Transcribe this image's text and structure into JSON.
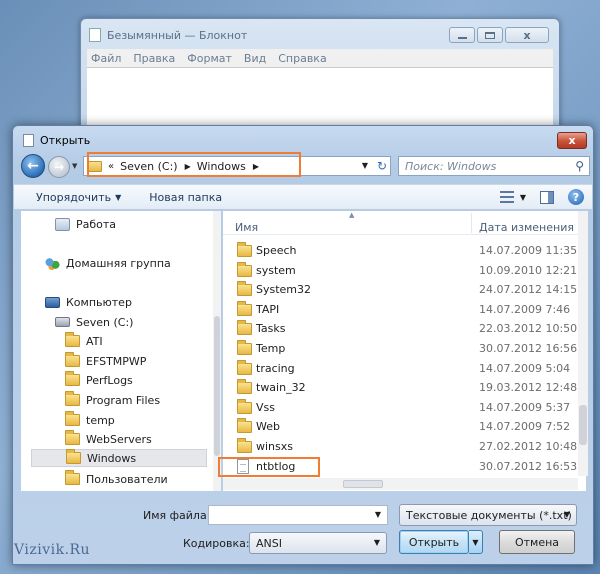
{
  "notepad": {
    "title": "Безымянный — Блокнот",
    "menu": [
      "Файл",
      "Правка",
      "Формат",
      "Вид",
      "Справка"
    ],
    "close_glyph": "x"
  },
  "dialog": {
    "title": "Открыть",
    "close_glyph": "x",
    "address": {
      "overflow": "«",
      "segments": [
        "Seven (C:)",
        "Windows"
      ]
    },
    "search_placeholder": "Поиск: Windows",
    "toolbar": {
      "organize": "Упорядочить",
      "new_folder": "Новая папка"
    },
    "nav": [
      {
        "label": "Работа",
        "icon": "work-icon"
      },
      {
        "label": "Домашняя группа",
        "icon": "homegroup-icon"
      },
      {
        "label": "Компьютер",
        "icon": "computer-icon"
      },
      {
        "label": "Seven (C:)",
        "icon": "drive-icon"
      },
      {
        "label": "ATI",
        "icon": "folder-icon"
      },
      {
        "label": "EFSTMPWP",
        "icon": "folder-icon"
      },
      {
        "label": "PerfLogs",
        "icon": "folder-icon"
      },
      {
        "label": "Program Files",
        "icon": "folder-icon"
      },
      {
        "label": "temp",
        "icon": "folder-icon"
      },
      {
        "label": "WebServers",
        "icon": "folder-icon"
      },
      {
        "label": "Windows",
        "icon": "folder-icon",
        "selected": true
      },
      {
        "label": "Пользователи",
        "icon": "folder-icon"
      }
    ],
    "columns": {
      "name": "Имя",
      "date": "Дата изменения"
    },
    "files": [
      {
        "name": "Speech",
        "date": "14.07.2009 11:35",
        "type": "folder"
      },
      {
        "name": "system",
        "date": "10.09.2010 12:21",
        "type": "folder"
      },
      {
        "name": "System32",
        "date": "24.07.2012 14:15",
        "type": "folder"
      },
      {
        "name": "TAPI",
        "date": "14.07.2009 7:46",
        "type": "folder"
      },
      {
        "name": "Tasks",
        "date": "22.03.2012 10:50",
        "type": "folder"
      },
      {
        "name": "Temp",
        "date": "30.07.2012 16:56",
        "type": "folder"
      },
      {
        "name": "tracing",
        "date": "14.07.2009 5:04",
        "type": "folder"
      },
      {
        "name": "twain_32",
        "date": "19.03.2012 12:48",
        "type": "folder"
      },
      {
        "name": "Vss",
        "date": "14.07.2009 5:37",
        "type": "folder"
      },
      {
        "name": "Web",
        "date": "14.07.2009 7:52",
        "type": "folder"
      },
      {
        "name": "winsxs",
        "date": "27.02.2012 10:48",
        "type": "folder"
      },
      {
        "name": "ntbtlog",
        "date": "30.07.2012 16:53",
        "type": "text"
      }
    ],
    "filename_label": "Имя файла:",
    "filename_value": "",
    "filetype_value": "Текстовые документы (*.txt)",
    "encoding_label": "Кодировка:",
    "encoding_value": "ANSI",
    "open_button": "Открыть",
    "cancel_button": "Отмена"
  },
  "watermark": "Vizivik.Ru",
  "colors": {
    "highlight": "#ef7d33",
    "accent": "#2c6fb8"
  }
}
